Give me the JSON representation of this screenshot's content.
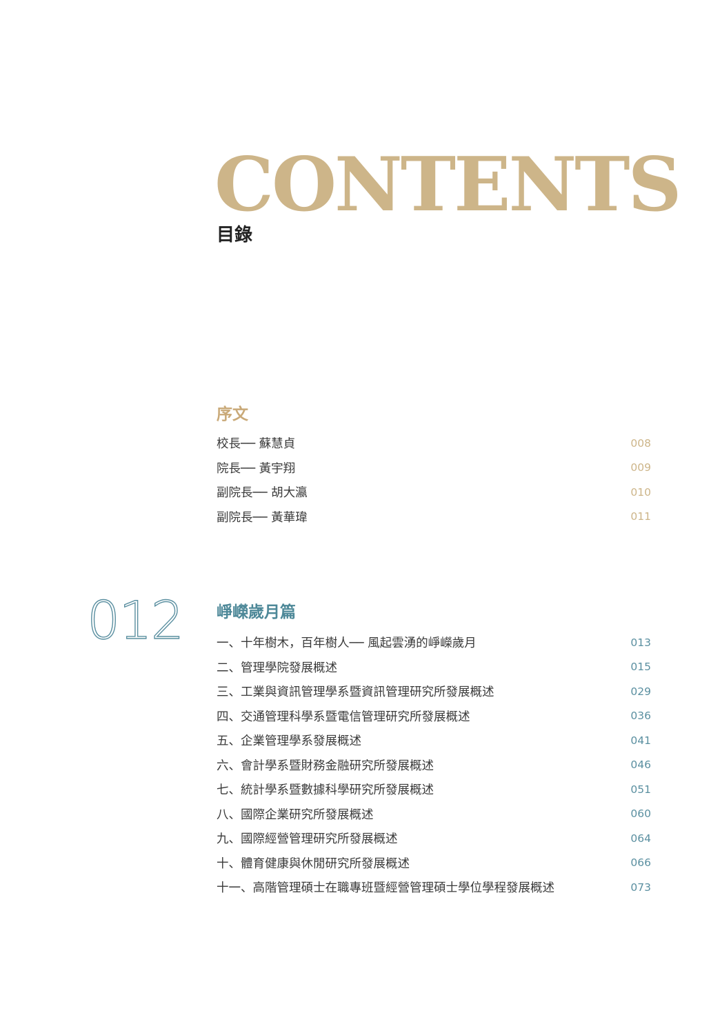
{
  "header": {
    "title_en": "CONTENTS",
    "title_zh": "目錄"
  },
  "colors": {
    "gold": "#cdb589",
    "teal": "#5a8fa0",
    "text": "#3a3a3a"
  },
  "sections": [
    {
      "heading": "序文",
      "items": [
        {
          "label": "校長── 蘇慧貞",
          "page": "008"
        },
        {
          "label": "院長── 黃宇翔",
          "page": "009"
        },
        {
          "label": "副院長── 胡大瀛",
          "page": "010"
        },
        {
          "label": "副院長── 黃華瑋",
          "page": "011"
        }
      ]
    },
    {
      "number": "012",
      "heading": "崢嶸歲月篇",
      "items": [
        {
          "label": "一、十年樹木，百年樹人── 風起雲湧的崢嶸歲月",
          "page": "013"
        },
        {
          "label": "二、管理學院發展概述",
          "page": "015"
        },
        {
          "label": "三、工業與資訊管理學系暨資訊管理研究所發展概述",
          "page": "029"
        },
        {
          "label": "四、交通管理科學系暨電信管理研究所發展概述",
          "page": "036"
        },
        {
          "label": "五、企業管理學系發展概述",
          "page": "041"
        },
        {
          "label": "六、會計學系暨財務金融研究所發展概述",
          "page": "046"
        },
        {
          "label": "七、統計學系暨數據科學研究所發展概述",
          "page": "051"
        },
        {
          "label": "八、國際企業研究所發展概述",
          "page": "060"
        },
        {
          "label": "九、國際經營管理研究所發展概述",
          "page": "064"
        },
        {
          "label": "十、體育健康與休閒研究所發展概述",
          "page": "066"
        },
        {
          "label": "十一、高階管理碩士在職專班暨經營管理碩士學位學程發展概述",
          "page": "073"
        }
      ]
    }
  ]
}
